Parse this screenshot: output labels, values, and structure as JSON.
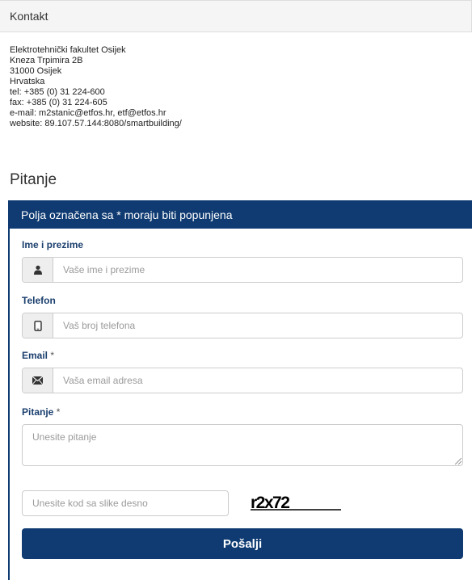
{
  "kontakt": {
    "heading": "Kontakt",
    "lines": [
      "Elektrotehnički fakultet Osijek",
      "Kneza Trpimira 2B",
      "31000 Osijek",
      "Hrvatska",
      "tel: +385 (0) 31 224-600",
      "fax: +385 (0) 31 224-605",
      "e-mail: m2stanic@etfos.hr, etf@etfos.hr",
      "website: 89.107.57.144:8080/smartbuilding/"
    ]
  },
  "pitanje_title": "Pitanje",
  "form": {
    "heading": "Polja označena sa * moraju biti popunjena",
    "name": {
      "label": "Ime i prezime",
      "placeholder": "Vaše ime i prezime",
      "value": ""
    },
    "phone": {
      "label": "Telefon",
      "placeholder": "Vaš broj telefona",
      "value": ""
    },
    "email": {
      "label": "Email",
      "required": "*",
      "placeholder": "Vaša email adresa",
      "value": ""
    },
    "question": {
      "label": "Pitanje",
      "required": "*",
      "placeholder": "Unesite pitanje",
      "value": ""
    },
    "captcha": {
      "placeholder": "Unesite kod sa slike desno",
      "value": "",
      "code": "r2x72"
    },
    "submit_label": "Pošalji"
  },
  "icons": {
    "name": "user-icon",
    "phone": "mobile-phone-icon",
    "email": "envelope-icon"
  },
  "colors": {
    "primary": "#0f3b72",
    "label": "#1b3f6e",
    "heading_bg": "#f5f5f5"
  }
}
